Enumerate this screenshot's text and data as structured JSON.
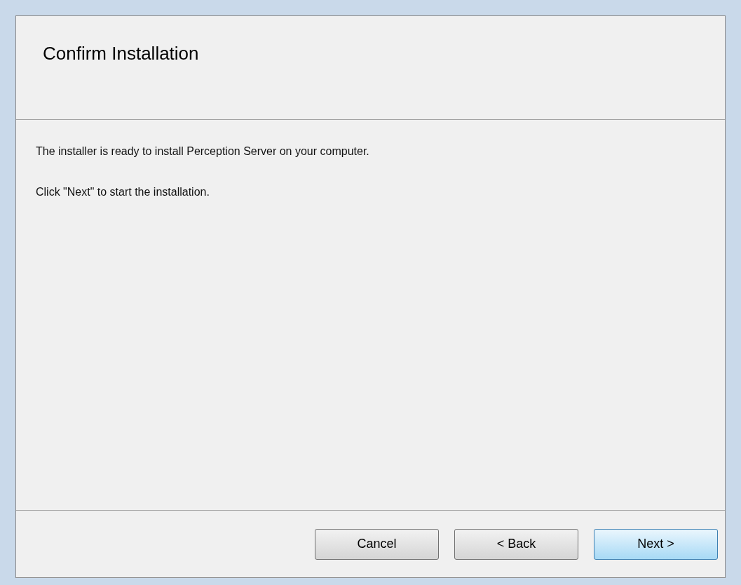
{
  "title": "Confirm Installation",
  "paragraphs": [
    "The installer is ready to install Perception Server on your computer.",
    "Click \"Next\" to start the installation."
  ],
  "buttons": [
    {
      "label": "Cancel",
      "focused": false
    },
    {
      "label": "< Back",
      "focused": false
    },
    {
      "label": "Next >",
      "focused": true
    }
  ]
}
